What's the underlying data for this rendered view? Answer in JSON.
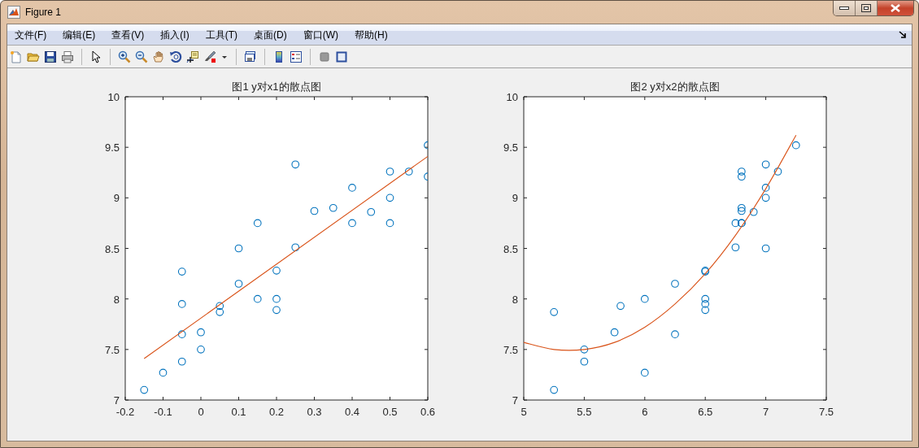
{
  "window": {
    "title": "Figure 1"
  },
  "menu": [
    "文件(F)",
    "编辑(E)",
    "查看(V)",
    "插入(I)",
    "工具(T)",
    "桌面(D)",
    "窗口(W)",
    "帮助(H)"
  ],
  "axes": [
    {
      "chart_data": {
        "type": "scatter",
        "title": "图1 y对x1的散点图",
        "xlim": [
          -0.2,
          0.6
        ],
        "ylim": [
          7,
          10
        ],
        "xticks": [
          -0.2,
          -0.1,
          0,
          0.1,
          0.2,
          0.3,
          0.4,
          0.5,
          0.6
        ],
        "yticks": [
          7,
          7.5,
          8,
          8.5,
          9,
          9.5,
          10
        ],
        "series": [
          {
            "type": "scatter",
            "color": "#0072bd",
            "x": [
              -0.05,
              0.25,
              0.6,
              0,
              0.25,
              0.2,
              0.15,
              0.05,
              -0.15,
              0.15,
              0.2,
              0.1,
              0.4,
              0.45,
              0.35,
              0.3,
              0.5,
              0.5,
              0.4,
              -0.05,
              -0.05,
              -0.1,
              0.2,
              0.1,
              0.5,
              0.6,
              -0.05,
              0,
              0.05,
              0.55
            ],
            "values": [
              7.38,
              8.51,
              9.52,
              7.5,
              9.33,
              8.28,
              8.75,
              7.87,
              7.1,
              8,
              7.89,
              8.15,
              9.1,
              8.86,
              8.9,
              8.87,
              9.26,
              9,
              8.75,
              7.95,
              7.65,
              7.27,
              8,
              8.5,
              8.75,
              9.21,
              8.27,
              7.67,
              7.93,
              9.26
            ]
          },
          {
            "type": "line",
            "color": "#d95319",
            "x": [
              -0.15,
              0.6
            ],
            "values": [
              7.41,
              9.41
            ]
          }
        ]
      }
    },
    {
      "chart_data": {
        "type": "scatter",
        "title": "图2 y对x2的散点图",
        "xlim": [
          5,
          7.5
        ],
        "ylim": [
          7,
          10
        ],
        "xticks": [
          5,
          5.5,
          6,
          6.5,
          7,
          7.5
        ],
        "yticks": [
          7,
          7.5,
          8,
          8.5,
          9,
          9.5,
          10
        ],
        "series": [
          {
            "type": "scatter",
            "color": "#0072bd",
            "x": [
              5.5,
              6.75,
              7.25,
              5.5,
              7,
              6.5,
              6.75,
              5.25,
              5.25,
              6,
              6.5,
              6.25,
              7,
              6.9,
              6.8,
              6.8,
              7.1,
              7,
              6.8,
              6.5,
              6.25,
              6,
              6.5,
              7,
              6.8,
              6.8,
              6.5,
              5.75,
              5.8,
              6.8
            ],
            "values": [
              7.38,
              8.51,
              9.52,
              7.5,
              9.33,
              8.28,
              8.75,
              7.87,
              7.1,
              8,
              7.89,
              8.15,
              9.1,
              8.86,
              8.9,
              8.87,
              9.26,
              9,
              8.75,
              7.95,
              7.65,
              7.27,
              8,
              8.5,
              9.26,
              9.21,
              8.27,
              7.67,
              7.93,
              8.75
            ]
          },
          {
            "type": "line",
            "color": "#d95319",
            "x": [
              5,
              5.25,
              5.5,
              5.75,
              6,
              6.25,
              6.5,
              6.75,
              7,
              7.25
            ],
            "values": [
              7.57,
              7.5,
              7.5,
              7.57,
              7.72,
              7.95,
              8.25,
              8.63,
              9.09,
              9.62
            ]
          }
        ]
      }
    }
  ]
}
